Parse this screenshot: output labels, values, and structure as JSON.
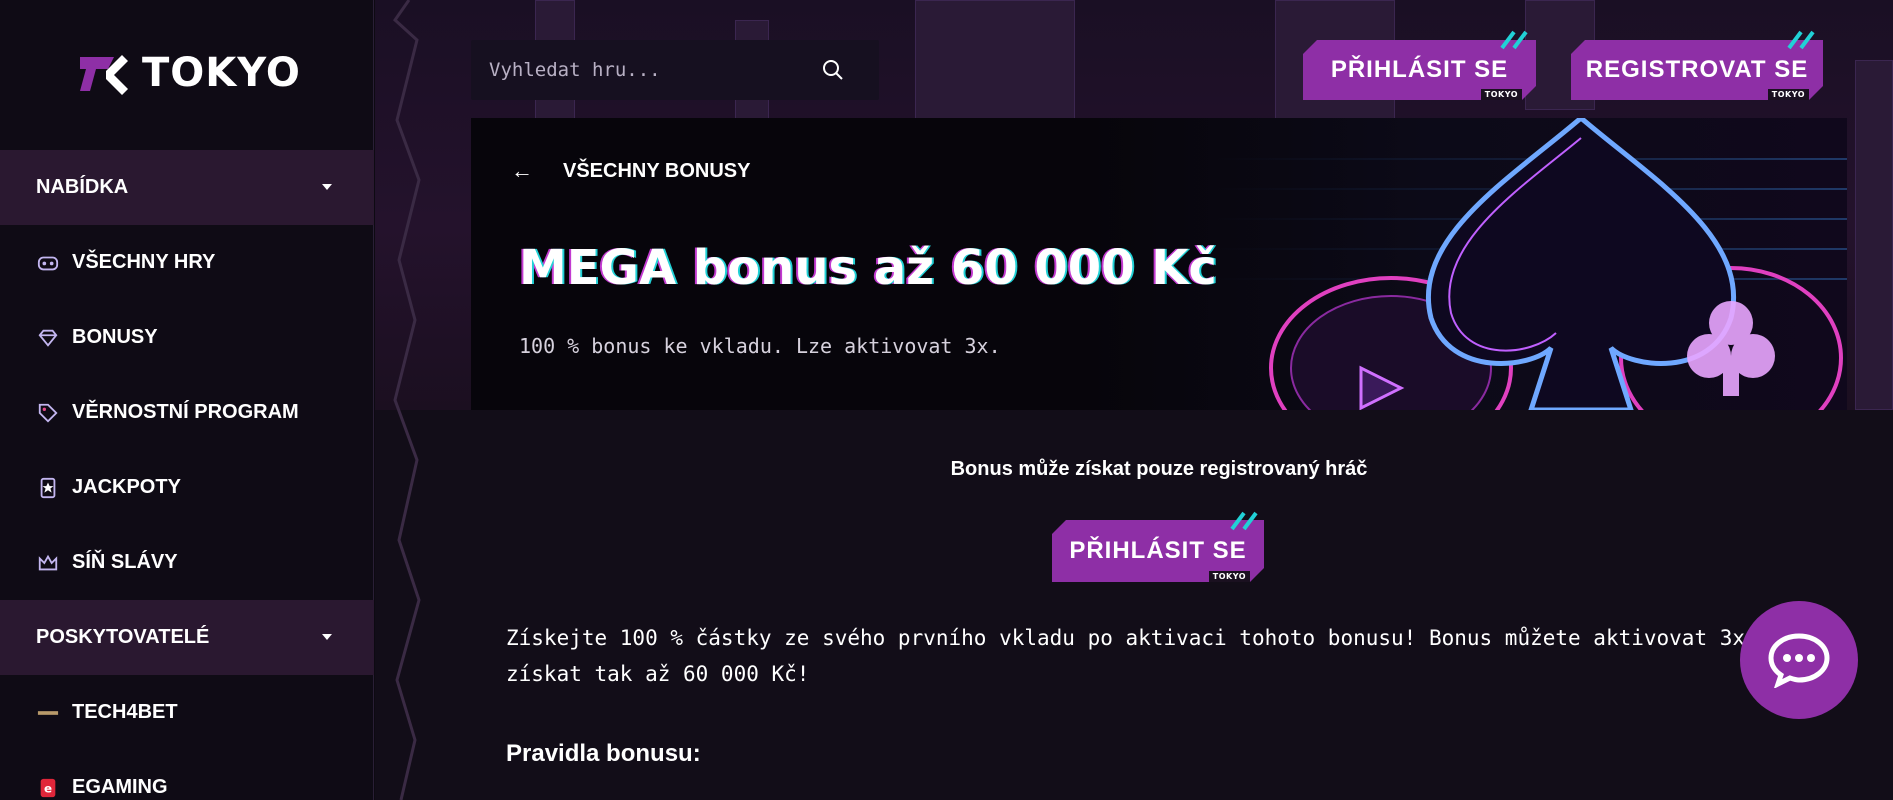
{
  "brand": {
    "name": "TOKYO",
    "tag": "TOKYO"
  },
  "search": {
    "placeholder": "Vyhledat hru..."
  },
  "header": {
    "login_label": "PŘIHLÁSIT SE",
    "register_label": "REGISTROVAT SE"
  },
  "sidebar": {
    "sections": [
      {
        "label": "NABÍDKA"
      },
      {
        "label": "POSKYTOVATELÉ"
      }
    ],
    "items": [
      {
        "label": "VŠECHNY HRY",
        "icon": "gamepad-icon"
      },
      {
        "label": "BONUSY",
        "icon": "diamond-icon"
      },
      {
        "label": "VĚRNOSTNÍ PROGRAM",
        "icon": "tag-icon"
      },
      {
        "label": "JACKPOTY",
        "icon": "medal-icon"
      },
      {
        "label": "SÍŇ SLÁVY",
        "icon": "crown-icon"
      }
    ],
    "providers": [
      {
        "label": "TECH4BET",
        "icon": "tech4bet-logo-icon"
      },
      {
        "label": "EGAMING",
        "icon": "egaming-logo-icon"
      }
    ]
  },
  "banner": {
    "back_label": "VŠECHNY BONUSY",
    "title": "MEGA bonus až 60 000 Kč",
    "subtitle": "100 % bonus ke vkladu. Lze aktivovat 3x."
  },
  "content": {
    "registered_note": "Bonus může získat pouze registrovaný hráč",
    "login_label": "PŘIHLÁSIT SE",
    "description": "Získejte 100 % částky ze svého prvního vkladu po aktivaci tohoto bonusu! Bonus můžete aktivovat 3x získat tak až 60 000 Kč!",
    "rules_title": "Pravidla bonusu:"
  },
  "colors": {
    "accent": "#8e2fa6",
    "section_bg": "#2a1830",
    "slash": "#21d1d6"
  }
}
